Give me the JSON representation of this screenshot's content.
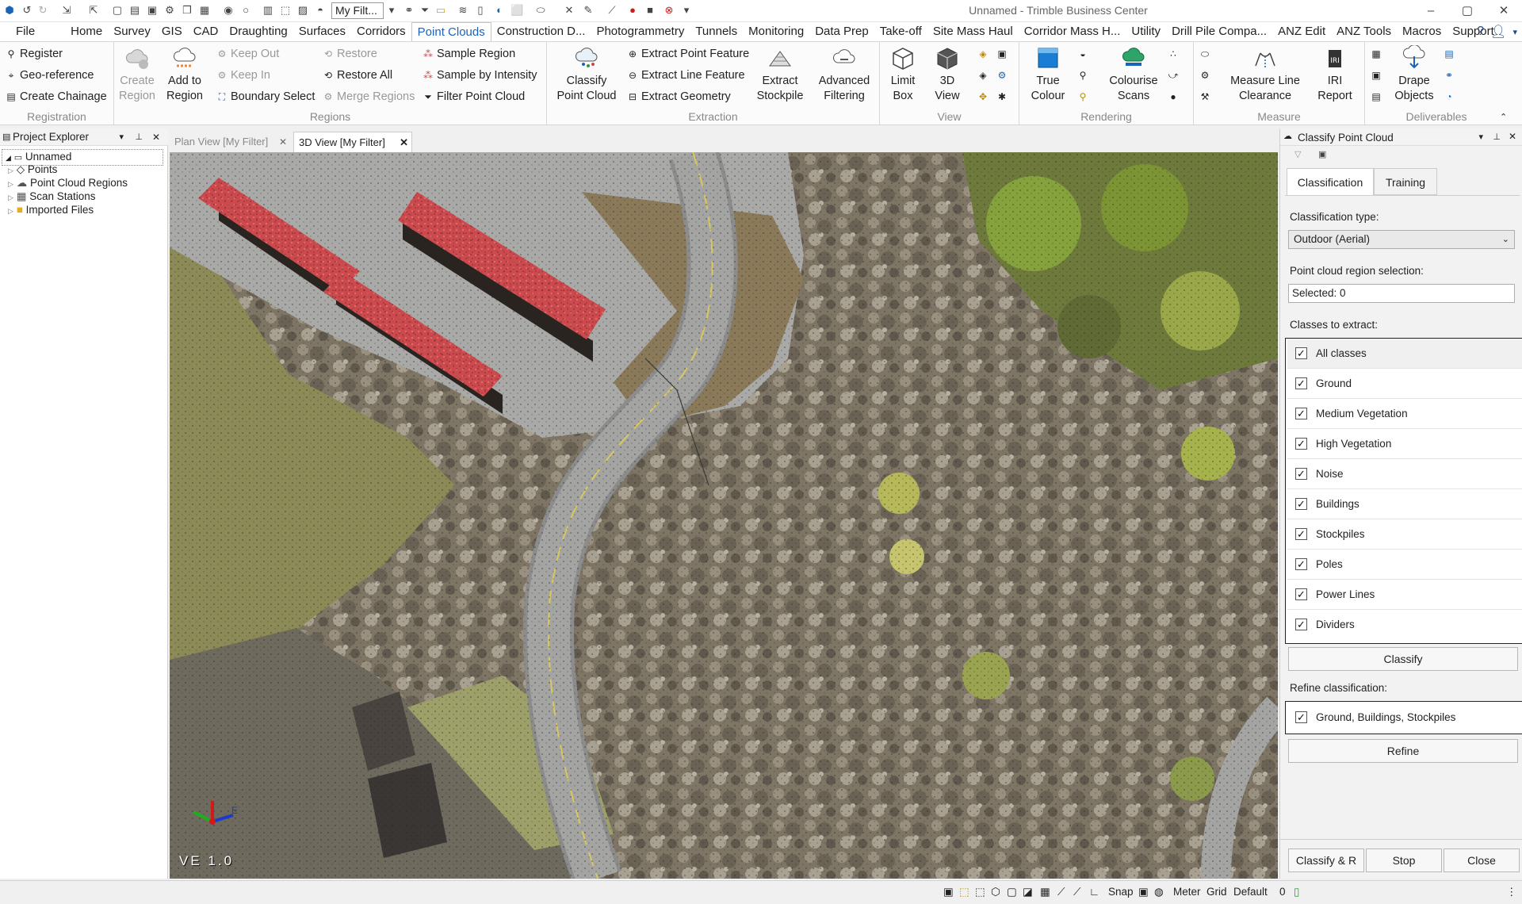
{
  "app": {
    "title": "Unnamed - Trimble Business Center",
    "filter_value": "My Filt..."
  },
  "menu": [
    {
      "label": "File"
    },
    {
      "label": "Home"
    },
    {
      "label": "Survey"
    },
    {
      "label": "GIS"
    },
    {
      "label": "CAD"
    },
    {
      "label": "Draughting"
    },
    {
      "label": "Surfaces"
    },
    {
      "label": "Corridors"
    },
    {
      "label": "Point Clouds"
    },
    {
      "label": "Construction D..."
    },
    {
      "label": "Photogrammetry"
    },
    {
      "label": "Tunnels"
    },
    {
      "label": "Monitoring"
    },
    {
      "label": "Data Prep"
    },
    {
      "label": "Take-off"
    },
    {
      "label": "Site Mass Haul"
    },
    {
      "label": "Corridor Mass H..."
    },
    {
      "label": "Utility"
    },
    {
      "label": "Drill Pile Compa..."
    },
    {
      "label": "ANZ Edit"
    },
    {
      "label": "ANZ Tools"
    },
    {
      "label": "Macros"
    },
    {
      "label": "Support"
    }
  ],
  "ribbon": {
    "registration": {
      "label": "Registration",
      "register": "Register",
      "georeference": "Geo-reference",
      "create_chainage": "Create Chainage"
    },
    "regions": {
      "label": "Regions",
      "create_region_1": "Create",
      "create_region_2": "Region",
      "add_to_region_1": "Add to",
      "add_to_region_2": "Region",
      "keep_out": "Keep Out",
      "keep_in": "Keep In",
      "boundary_select": "Boundary Select",
      "restore": "Restore",
      "restore_all": "Restore All",
      "merge_regions": "Merge Regions",
      "sample_region": "Sample Region",
      "sample_by_intensity": "Sample by Intensity",
      "filter_point_cloud": "Filter Point Cloud"
    },
    "extraction": {
      "label": "Extraction",
      "classify_1": "Classify",
      "classify_2": "Point Cloud",
      "extract_point_feature": "Extract Point Feature",
      "extract_line_feature": "Extract Line Feature",
      "extract_geometry": "Extract Geometry",
      "extract_stockpile_1": "Extract",
      "extract_stockpile_2": "Stockpile",
      "advanced_filtering_1": "Advanced",
      "advanced_filtering_2": "Filtering"
    },
    "view": {
      "label": "View",
      "limit_box_1": "Limit",
      "limit_box_2": "Box",
      "view3d_1": "3D",
      "view3d_2": "View"
    },
    "rendering": {
      "label": "Rendering",
      "true_colour_1": "True",
      "true_colour_2": "Colour",
      "colourise_1": "Colourise",
      "colourise_2": "Scans"
    },
    "measure": {
      "label": "Measure",
      "measure_line_1": "Measure Line",
      "measure_line_2": "Clearance",
      "iri_1": "IRI",
      "iri_2": "Report"
    },
    "deliverables": {
      "label": "Deliverables",
      "drape_1": "Drape",
      "drape_2": "Objects"
    }
  },
  "project_explorer": {
    "title": "Project Explorer",
    "root": "Unnamed",
    "items": [
      {
        "label": "Points"
      },
      {
        "label": "Point Cloud Regions"
      },
      {
        "label": "Scan Stations"
      },
      {
        "label": "Imported Files"
      }
    ]
  },
  "tabs": [
    {
      "label": "Plan View [My Filter]"
    },
    {
      "label": "3D View [My Filter]"
    }
  ],
  "viewport": {
    "ve_label": "VE 1.0",
    "axis_e": "E"
  },
  "classify_panel": {
    "title": "Classify Point Cloud",
    "tab_classification": "Classification",
    "tab_training": "Training",
    "classification_type_label": "Classification type:",
    "classification_type_value": "Outdoor (Aerial)",
    "region_label": "Point cloud region selection:",
    "region_value": "Selected: 0",
    "classes_label": "Classes to extract:",
    "classes": [
      {
        "label": "All classes",
        "checked": true
      },
      {
        "label": "Ground",
        "checked": true
      },
      {
        "label": "Medium Vegetation",
        "checked": true
      },
      {
        "label": "High Vegetation",
        "checked": true
      },
      {
        "label": "Noise",
        "checked": true
      },
      {
        "label": "Buildings",
        "checked": true
      },
      {
        "label": "Stockpiles",
        "checked": true
      },
      {
        "label": "Poles",
        "checked": true
      },
      {
        "label": "Power Lines",
        "checked": true
      },
      {
        "label": "Dividers",
        "checked": true
      }
    ],
    "classify_button": "Classify",
    "refine_label": "Refine classification:",
    "refine_item": "Ground, Buildings, Stockpiles",
    "refine_button": "Refine",
    "classify_refine_button": "Classify & R",
    "stop_button": "Stop",
    "close_button": "Close"
  },
  "statusbar": {
    "snap": "Snap",
    "units": "Meter",
    "grid": "Grid",
    "default": "Default",
    "count": "0"
  },
  "colors": {
    "accent": "#1a63b8",
    "stockpile_red": "#c8474b",
    "road": "#9a9a9a"
  }
}
